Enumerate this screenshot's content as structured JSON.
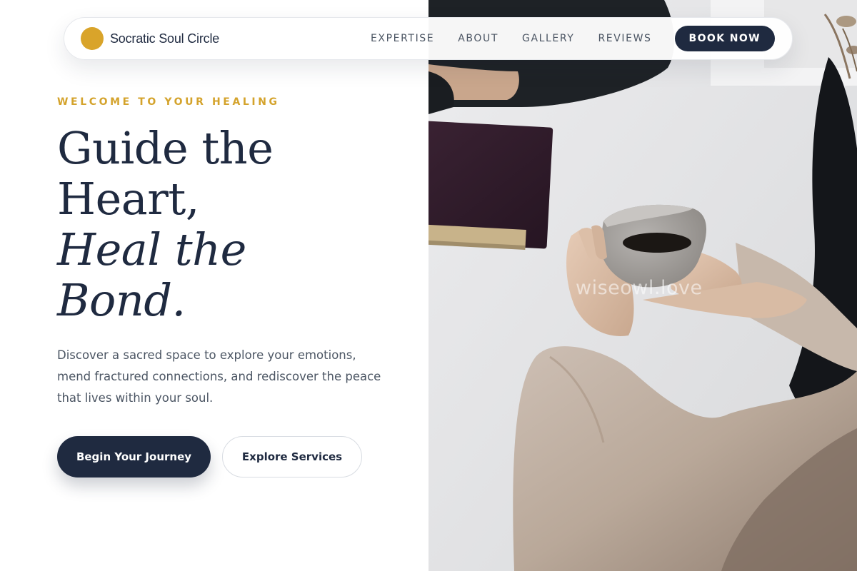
{
  "brand": {
    "name": "Socratic Soul Circle",
    "accent_color": "#d9a42a"
  },
  "nav": {
    "links": [
      "EXPERTISE",
      "ABOUT",
      "GALLERY",
      "REVIEWS"
    ],
    "book_label": "BOOK NOW"
  },
  "hero": {
    "eyebrow": "WELCOME TO YOUR HEALING",
    "headline_line1": "Guide the",
    "headline_line2": "Heart,",
    "headline_line3": "Heal the",
    "headline_line4": "Bond.",
    "lede": "Discover a sacred space to explore your emotions, mend fractured connections, and rediscover the peace that lives within your soul.",
    "primary_cta": "Begin Your Journey",
    "secondary_cta": "Explore Services"
  },
  "photo": {
    "watermark": "wiseowl.love"
  },
  "colors": {
    "navy": "#1f2a40",
    "gold": "#d4a32c",
    "body_text": "#4b5563"
  }
}
